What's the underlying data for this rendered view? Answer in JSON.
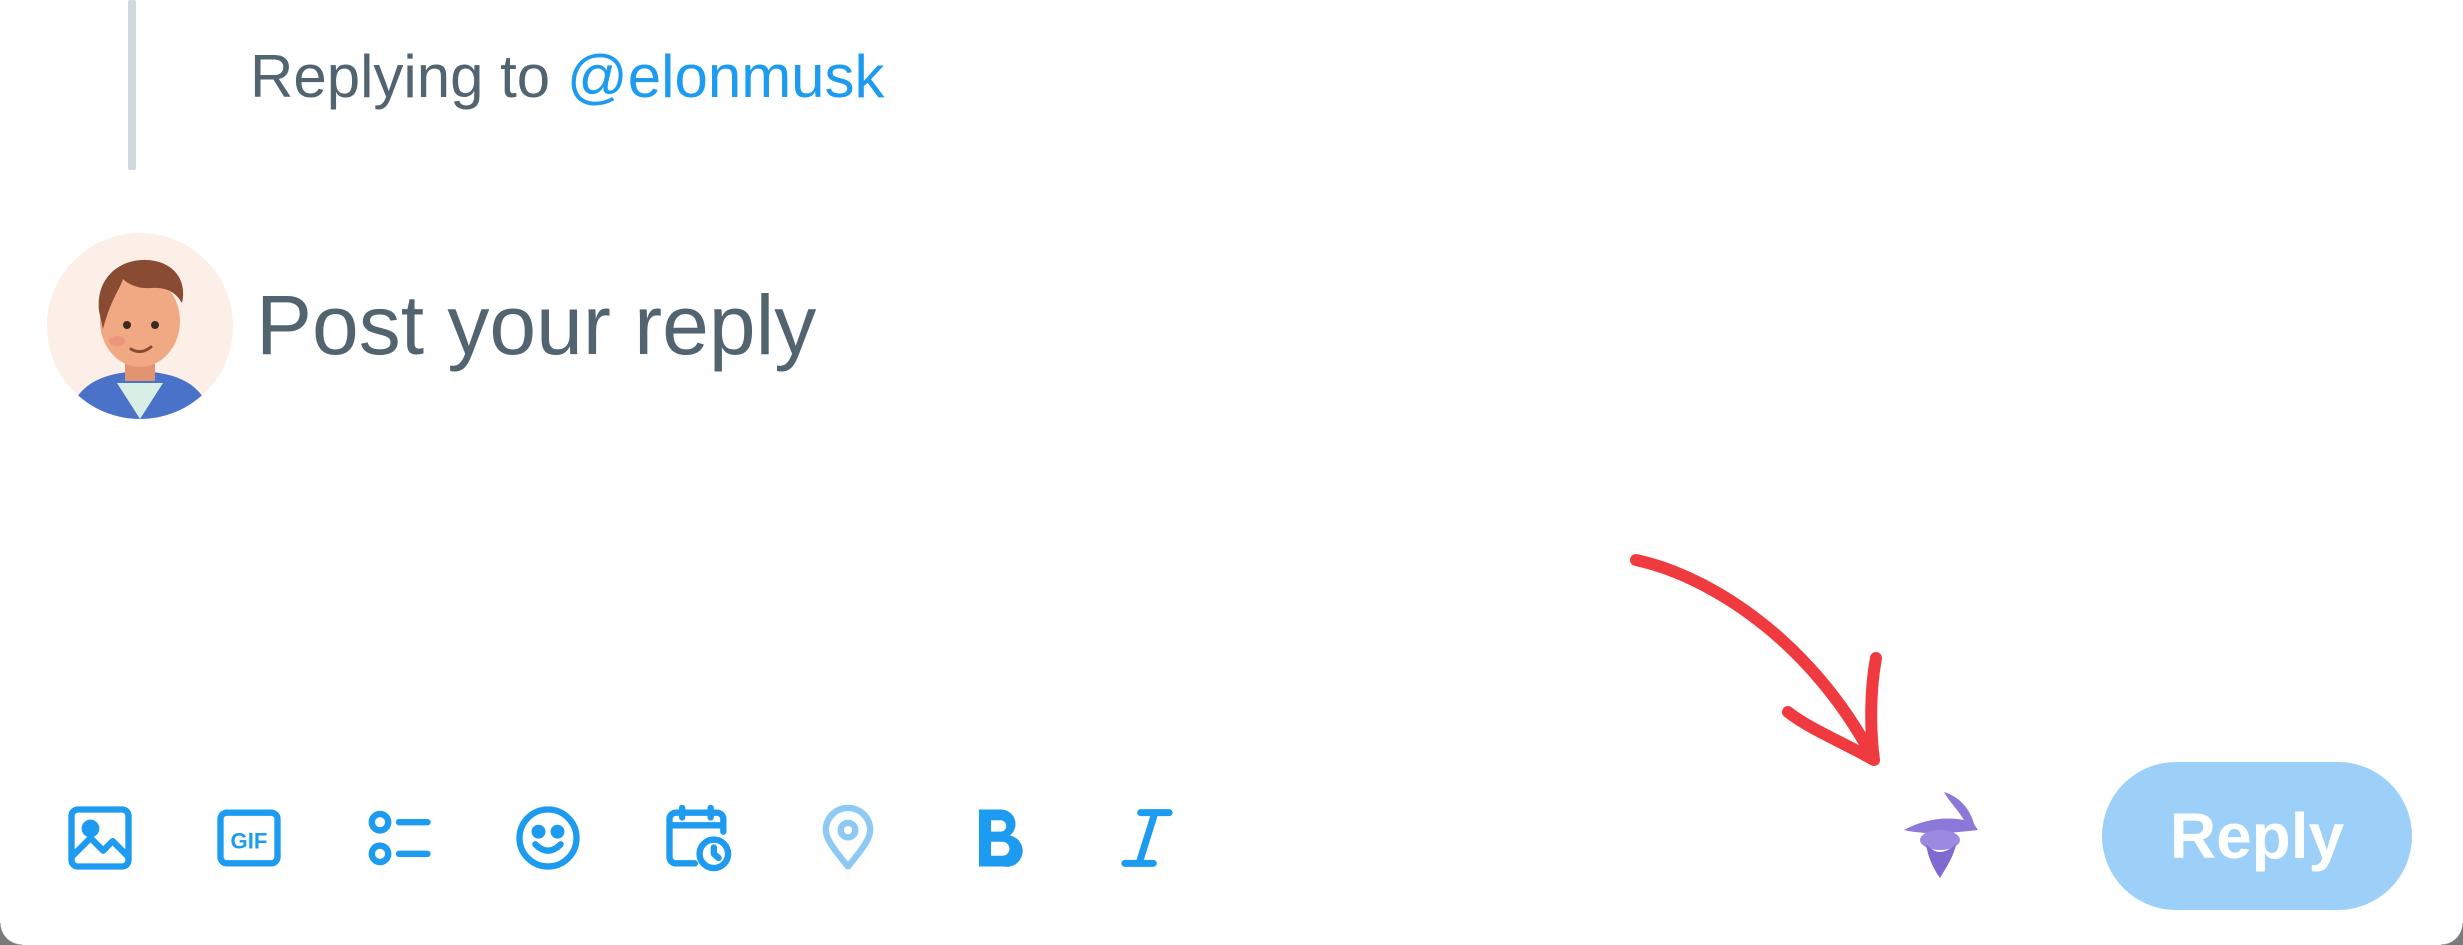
{
  "reply_context": {
    "prefix": "Replying to ",
    "handle": "@elonmusk"
  },
  "composer": {
    "placeholder": "Post your reply"
  },
  "toolbar": {
    "icons": [
      {
        "name": "image-icon"
      },
      {
        "name": "gif-icon"
      },
      {
        "name": "poll-icon"
      },
      {
        "name": "emoji-icon"
      },
      {
        "name": "schedule-icon"
      },
      {
        "name": "location-icon"
      },
      {
        "name": "bold-icon"
      },
      {
        "name": "italic-icon"
      }
    ],
    "extension_icon": "wizard-icon"
  },
  "reply_button": {
    "label": "Reply"
  },
  "annotation": {
    "type": "arrow",
    "color": "#ef3b3f"
  },
  "colors": {
    "accent": "#1d9bf0",
    "accent_disabled": "#9dd0f8",
    "muted_text": "#536471",
    "thread_line": "#cfd9de",
    "wizard": "#8b78d8"
  }
}
